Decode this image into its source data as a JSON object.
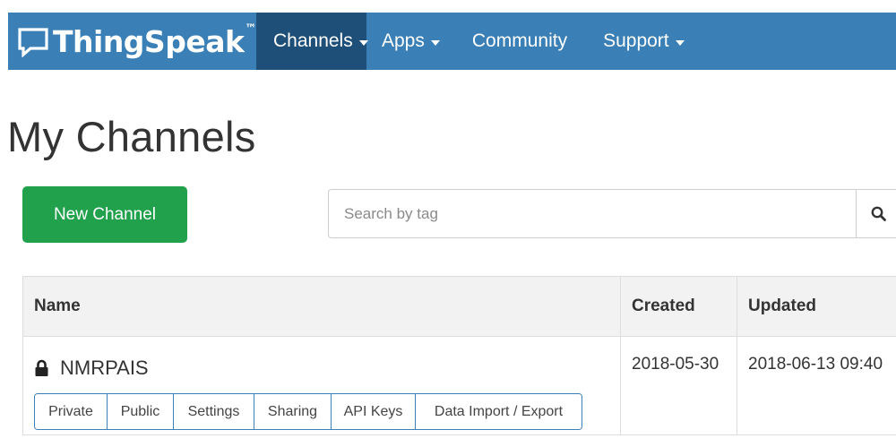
{
  "navbar": {
    "brand": "ThingSpeak",
    "trademark": "™",
    "items": [
      {
        "label": "Channels",
        "dropdown": true,
        "active": true
      },
      {
        "label": "Apps",
        "dropdown": true,
        "active": false
      },
      {
        "label": "Community",
        "dropdown": false,
        "active": false
      },
      {
        "label": "Support",
        "dropdown": true,
        "active": false
      }
    ]
  },
  "page": {
    "title": "My Channels"
  },
  "toolbar": {
    "new_channel_label": "New Channel",
    "search_placeholder": "Search by tag"
  },
  "table": {
    "headers": {
      "name": "Name",
      "created": "Created",
      "updated": "Updated"
    },
    "rows": [
      {
        "name": "NMRPAIS",
        "visibility": "private",
        "created": "2018-05-30",
        "updated": "2018-06-13 09:40",
        "tabs": [
          "Private",
          "Public",
          "Settings",
          "Sharing",
          "API Keys",
          "Data Import / Export"
        ]
      }
    ]
  },
  "colors": {
    "navbar": "#3a7fb6",
    "navbar_active": "#1e4f78",
    "primary_button": "#21a14c",
    "table_header_bg": "#f2f2f2"
  },
  "icons": {
    "brand": "chat-bubble-icon",
    "search": "search-icon",
    "lock": "lock-icon",
    "caret": "caret-down-icon"
  }
}
